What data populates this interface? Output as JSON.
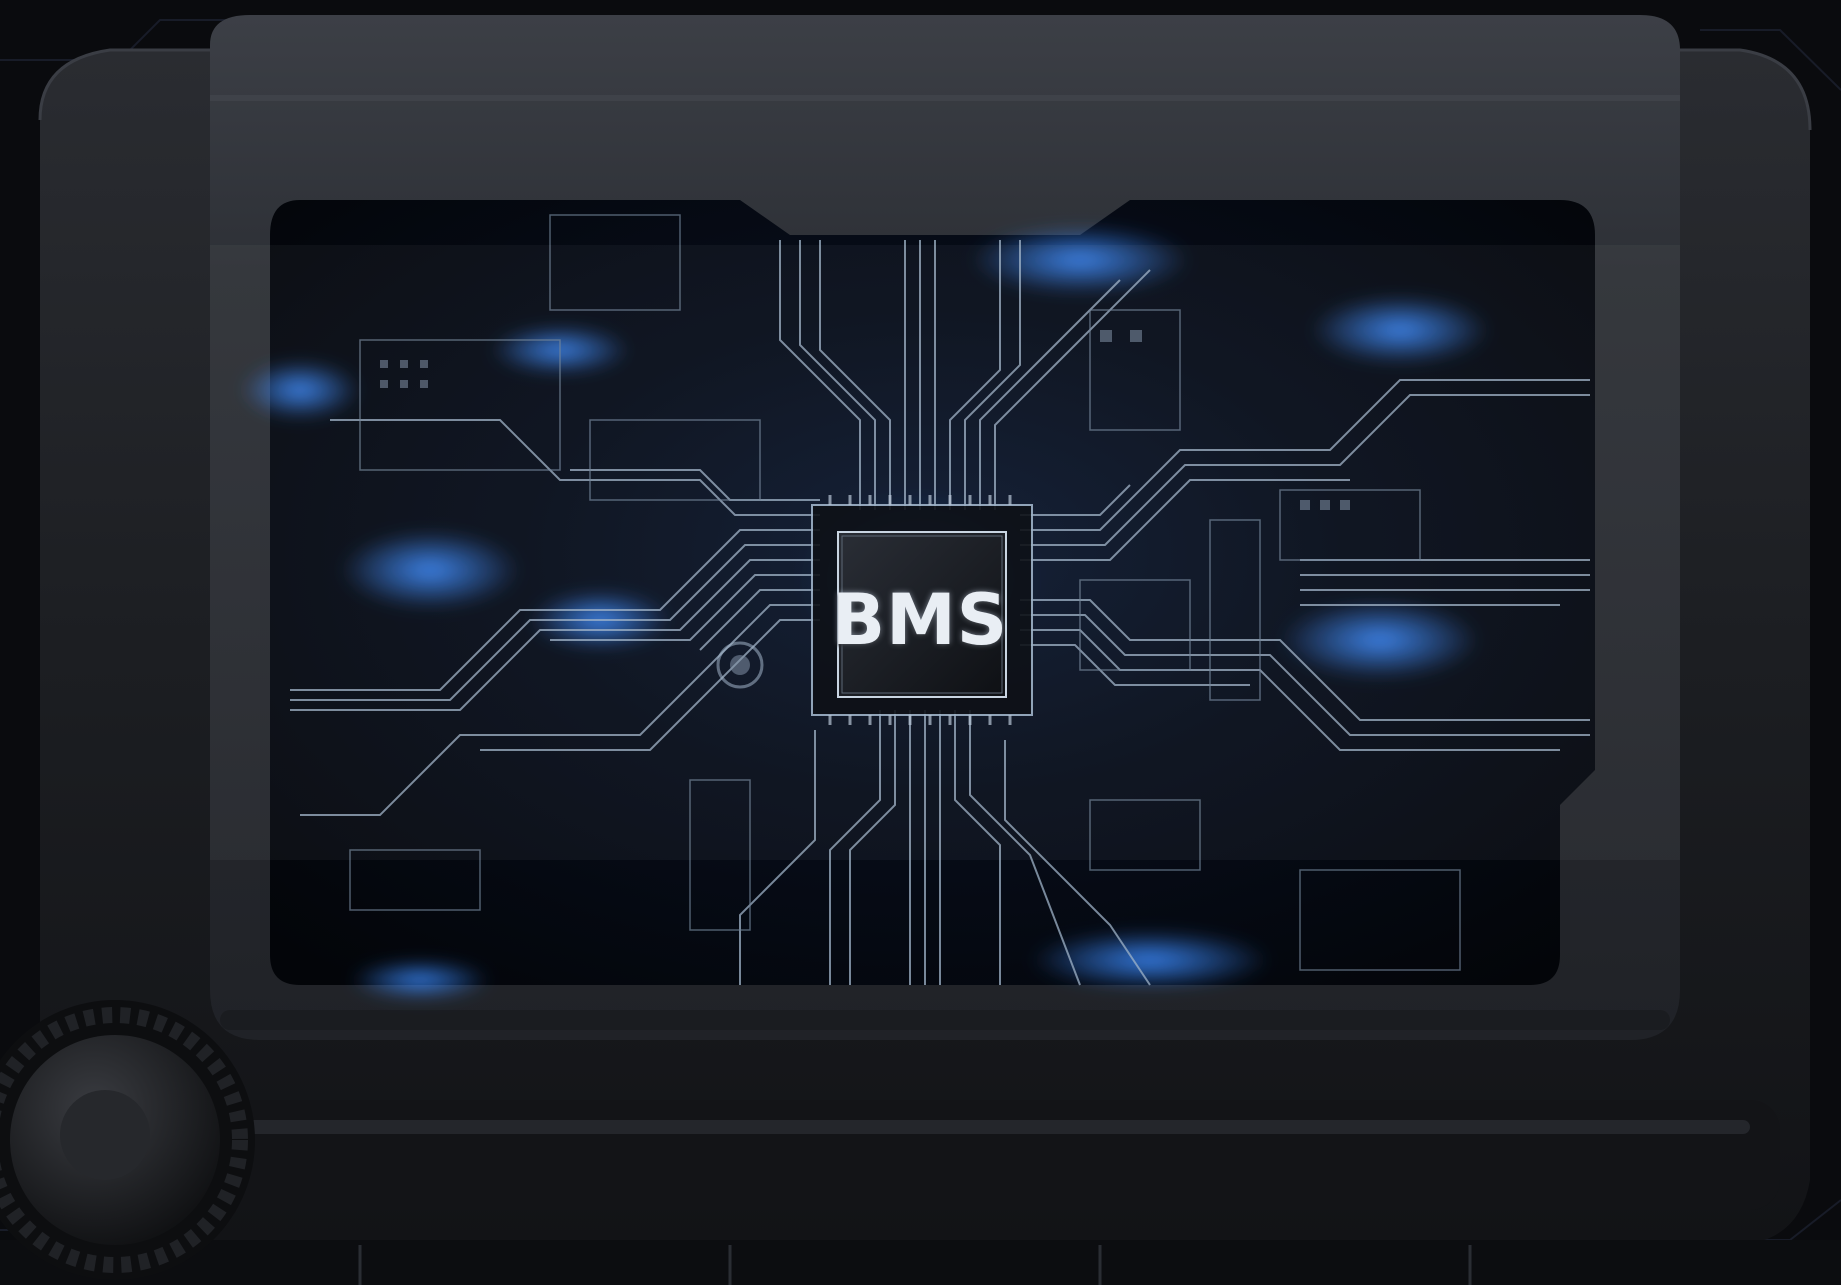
{
  "chip": {
    "label": "BMS"
  },
  "colors": {
    "background": "#0a0b0e",
    "device_body": "#1b1d21",
    "device_frame": "#2e3036",
    "circuit_board": "#05080f",
    "circuit_trace": "#9fb3c8",
    "glow_accent": "#2f7bff"
  },
  "icons": {
    "chip": "processor-chip-icon",
    "knob": "rotary-knob-icon"
  }
}
